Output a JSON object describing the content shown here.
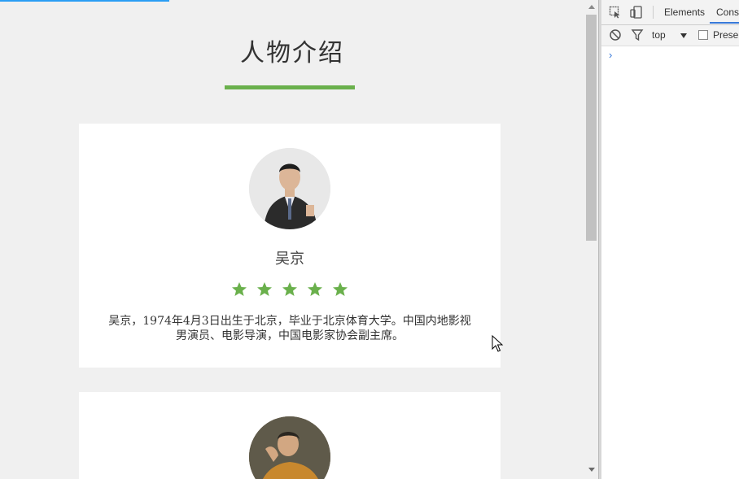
{
  "page": {
    "title": "人物介绍",
    "accent_color": "#6ab04c",
    "loading_progress": 0.29
  },
  "cards": [
    {
      "name": "吴京",
      "rating": 5,
      "rating_max": 5,
      "description": "吴京，1974年4月3日出生于北京，毕业于北京体育大学。中国内地影视男演员、电影导演，中国电影家协会副主席。",
      "avatar_icon": "person-photo-icon"
    },
    {
      "avatar_icon": "person-photo-icon"
    }
  ],
  "devtools": {
    "tabs": [
      {
        "label": "Elements"
      },
      {
        "label": "Console",
        "active": true
      }
    ],
    "context_value": "top",
    "preserve_log_label": "Preserve log",
    "prompt_symbol": "›"
  }
}
